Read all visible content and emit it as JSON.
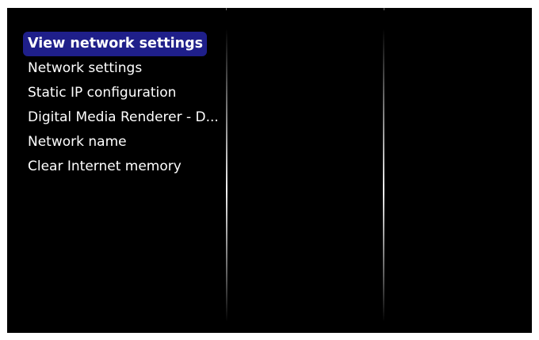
{
  "menu": {
    "items": [
      {
        "label": "View network settings",
        "selected": true
      },
      {
        "label": "Network settings",
        "selected": false
      },
      {
        "label": "Static IP configuration",
        "selected": false
      },
      {
        "label": "Digital Media Renderer - D...",
        "selected": false
      },
      {
        "label": "Network name",
        "selected": false
      },
      {
        "label": "Clear Internet memory",
        "selected": false
      }
    ]
  },
  "colors": {
    "background": "#000000",
    "highlight": "#1f1f8a",
    "text": "#ffffff"
  }
}
